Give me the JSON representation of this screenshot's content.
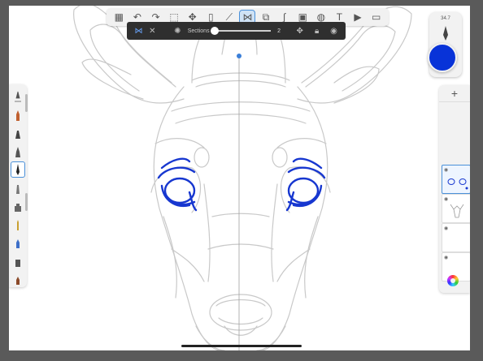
{
  "toolbar": {
    "items": [
      {
        "name": "gallery-icon",
        "glyph": "▦"
      },
      {
        "name": "undo-icon",
        "glyph": "↶"
      },
      {
        "name": "redo-icon",
        "glyph": "↷"
      },
      {
        "name": "selection-icon",
        "glyph": "⬚"
      },
      {
        "name": "transform-icon",
        "glyph": "✥"
      },
      {
        "name": "layer-copy-icon",
        "glyph": "▯"
      },
      {
        "name": "ruler-icon",
        "glyph": "⟋"
      },
      {
        "name": "symmetry-icon",
        "glyph": "⋈",
        "active": true
      },
      {
        "name": "shapes-icon",
        "glyph": "⧉"
      },
      {
        "name": "curve-icon",
        "glyph": "∫"
      },
      {
        "name": "image-icon",
        "glyph": "▣"
      },
      {
        "name": "perspective-icon",
        "glyph": "◍"
      },
      {
        "name": "text-icon",
        "glyph": "T"
      },
      {
        "name": "video-icon",
        "glyph": "▶"
      },
      {
        "name": "fullscreen-icon",
        "glyph": "▭"
      }
    ]
  },
  "symmetry_panel": {
    "sections_label": "Sections",
    "sections_value": "2",
    "slider_level": 0.0
  },
  "brush": {
    "size_label": "34.7",
    "color": "#0833d8"
  },
  "brush_library": {
    "count": 11,
    "selected_index": 4
  },
  "layers": {
    "add_label": "+"
  }
}
